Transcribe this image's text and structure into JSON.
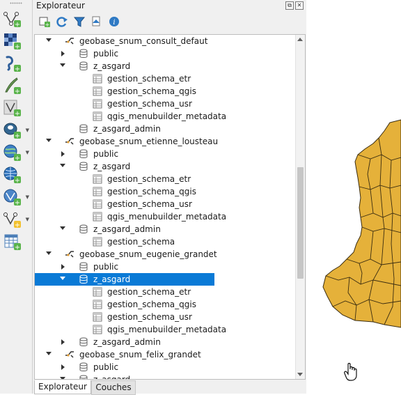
{
  "panel": {
    "title": "Explorateur",
    "float_icon": "⧉",
    "close_icon": "✕"
  },
  "toolbar_left": [
    {
      "icon": "new-vector-layer-icon"
    },
    {
      "icon": "new-raster-layer-icon"
    },
    {
      "icon": "new-point-layer-icon"
    },
    {
      "icon": "digitize-icon"
    },
    {
      "icon": "vector-layer-icon"
    },
    {
      "icon": "postgis-add-icon"
    },
    {
      "icon": "wms-add-icon"
    },
    {
      "icon": "globe-add-icon"
    },
    {
      "icon": "wfs-add-icon"
    },
    {
      "icon": "virtual-layer-icon"
    },
    {
      "icon": "table-add-icon"
    }
  ],
  "panel_toolbar": [
    {
      "icon": "add-selected-layers-icon"
    },
    {
      "icon": "refresh-icon"
    },
    {
      "icon": "filter-icon"
    },
    {
      "icon": "collapse-all-icon"
    },
    {
      "icon": "info-icon"
    }
  ],
  "tree": [
    {
      "level": 0,
      "type": "connection",
      "expanded": true,
      "label": "geobase_snum_consult_defaut"
    },
    {
      "level": 1,
      "type": "schema",
      "expanded": false,
      "label": "public"
    },
    {
      "level": 1,
      "type": "schema",
      "expanded": true,
      "label": "z_asgard"
    },
    {
      "level": 2,
      "type": "table",
      "label": "gestion_schema_etr"
    },
    {
      "level": 2,
      "type": "table",
      "label": "gestion_schema_qgis"
    },
    {
      "level": 2,
      "type": "table",
      "label": "gestion_schema_usr"
    },
    {
      "level": 2,
      "type": "table",
      "label": "qgis_menubuilder_metadata"
    },
    {
      "level": 1,
      "type": "schema",
      "label": "z_asgard_admin"
    },
    {
      "level": 0,
      "type": "connection",
      "expanded": true,
      "label": "geobase_snum_etienne_lousteau"
    },
    {
      "level": 1,
      "type": "schema",
      "expanded": false,
      "label": "public"
    },
    {
      "level": 1,
      "type": "schema",
      "expanded": true,
      "label": "z_asgard"
    },
    {
      "level": 2,
      "type": "table",
      "label": "gestion_schema_etr"
    },
    {
      "level": 2,
      "type": "table",
      "label": "gestion_schema_qgis"
    },
    {
      "level": 2,
      "type": "table",
      "label": "gestion_schema_usr"
    },
    {
      "level": 2,
      "type": "table",
      "label": "qgis_menubuilder_metadata"
    },
    {
      "level": 1,
      "type": "schema",
      "expanded": true,
      "label": "z_asgard_admin"
    },
    {
      "level": 2,
      "type": "table",
      "label": "gestion_schema"
    },
    {
      "level": 0,
      "type": "connection",
      "expanded": true,
      "label": "geobase_snum_eugenie_grandet"
    },
    {
      "level": 1,
      "type": "schema",
      "expanded": false,
      "label": "public"
    },
    {
      "level": 1,
      "type": "schema",
      "expanded": true,
      "selected": true,
      "label": "z_asgard"
    },
    {
      "level": 2,
      "type": "table",
      "label": "gestion_schema_etr"
    },
    {
      "level": 2,
      "type": "table",
      "label": "gestion_schema_qgis"
    },
    {
      "level": 2,
      "type": "table",
      "label": "gestion_schema_usr"
    },
    {
      "level": 2,
      "type": "table",
      "label": "qgis_menubuilder_metadata"
    },
    {
      "level": 1,
      "type": "schema",
      "expanded": false,
      "label": "z_asgard_admin"
    },
    {
      "level": 0,
      "type": "connection",
      "expanded": true,
      "label": "geobase_snum_felix_grandet"
    },
    {
      "level": 1,
      "type": "schema",
      "expanded": false,
      "label": "public"
    },
    {
      "level": 1,
      "type": "schema",
      "expanded": true,
      "label": "z_asgard"
    }
  ],
  "tabs": [
    {
      "label": "Explorateur",
      "active": true
    },
    {
      "label": "Couches",
      "active": false
    }
  ],
  "colors": {
    "selection": "#0a7ad6",
    "map_fill": "#e5b13a",
    "map_stroke": "#3a2c10"
  }
}
